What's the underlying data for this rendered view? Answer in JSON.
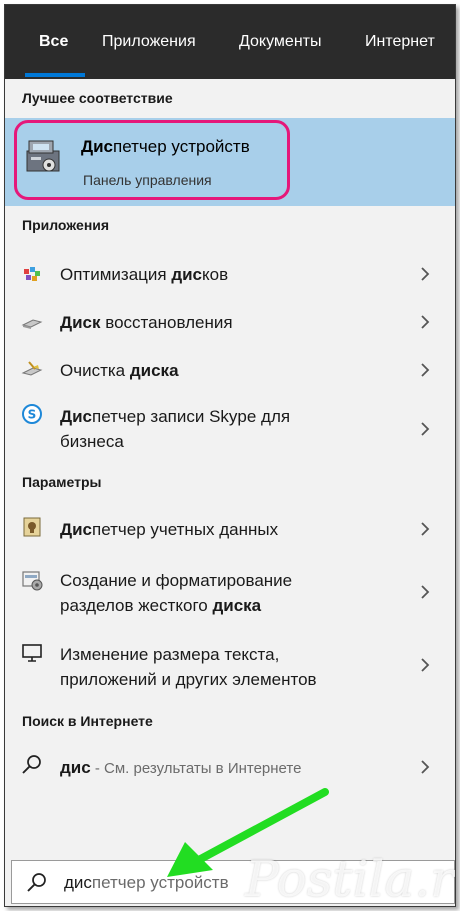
{
  "tabs": [
    {
      "label": "Все",
      "active": true
    },
    {
      "label": "Приложения",
      "active": false
    },
    {
      "label": "Документы",
      "active": false
    },
    {
      "label": "Интернет",
      "active": false
    }
  ],
  "best_match": {
    "header": "Лучшее соответствие",
    "title_bold": "Дис",
    "title_rest": "петчер устройств",
    "subtitle": "Панель управления",
    "icon": "device-manager-icon",
    "highlight_color": "#e5187a"
  },
  "apps": {
    "header": "Приложения",
    "items": [
      {
        "pre": "Оптимизация ",
        "bold": "дис",
        "post": "ков",
        "icon": "defrag-icon"
      },
      {
        "pre": "",
        "bold": "Диск",
        "post": " восстановления",
        "icon": "recovery-drive-icon"
      },
      {
        "pre": "Очистка ",
        "bold": "диска",
        "post": "",
        "icon": "disk-cleanup-icon"
      },
      {
        "pre": "",
        "bold": "Дис",
        "post": "петчер записи Skype для",
        "line2": "бизнеса",
        "icon": "skype-icon"
      }
    ]
  },
  "settings": {
    "header": "Параметры",
    "items": [
      {
        "line1_pre": "",
        "line1_bold": "Дис",
        "line1_post": "петчер учетных данных",
        "icon": "credential-manager-icon"
      },
      {
        "line1": "Создание и форматирование",
        "line2_pre": "разделов жесткого ",
        "line2_bold": "диска",
        "icon": "disk-management-icon"
      },
      {
        "line1": "Изменение размера текста,",
        "line2": "приложений и других элементов",
        "icon": "display-icon"
      }
    ]
  },
  "web": {
    "header": "Поиск в Интернете",
    "query": "дис",
    "hint": " - См. результаты в Интернете",
    "icon": "search-icon"
  },
  "searchbox": {
    "typed": "дис",
    "suggestion": "петчер устройств",
    "icon": "search-icon"
  },
  "watermark": "Postila.ru",
  "colors": {
    "accent": "#0078d7",
    "selected_bg": "#a8cfea",
    "annotation_arrow": "#22dd22"
  }
}
